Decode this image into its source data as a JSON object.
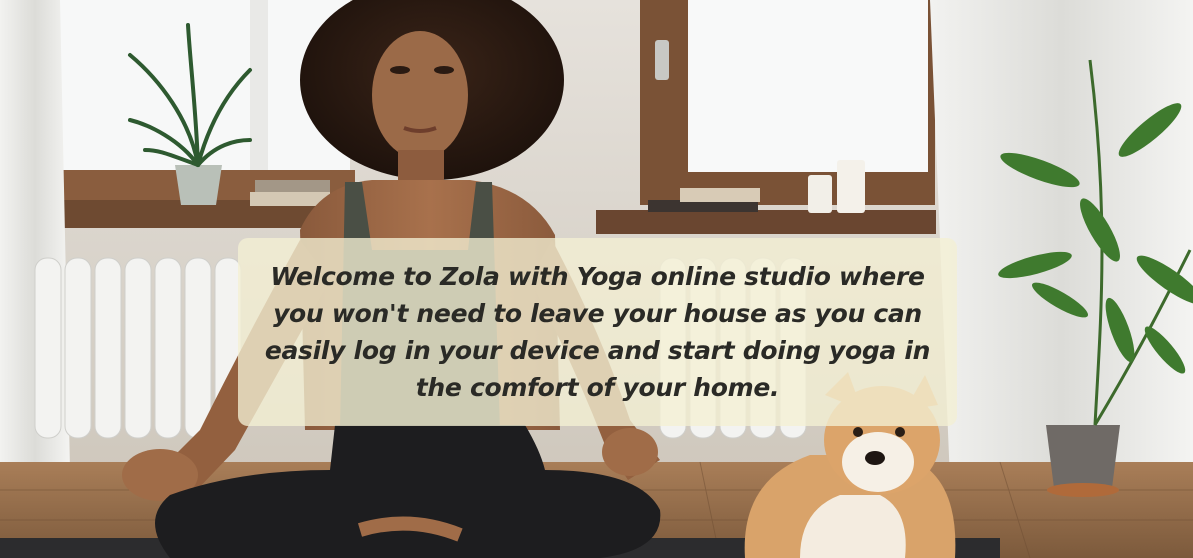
{
  "hero": {
    "background_description_icon": "yoga-woman-meditating-with-dog-photo",
    "welcome_message": "Welcome to Zola with Yoga online studio where you won't need to leave your house as you can easily log in your device and start doing yoga in the comfort of your home."
  },
  "colors": {
    "overlay": "#f4f0d3",
    "text": "#2a2a26",
    "wall": "#d9d4cb",
    "floor": "#9a7350",
    "window_frame": "#7a5236"
  }
}
